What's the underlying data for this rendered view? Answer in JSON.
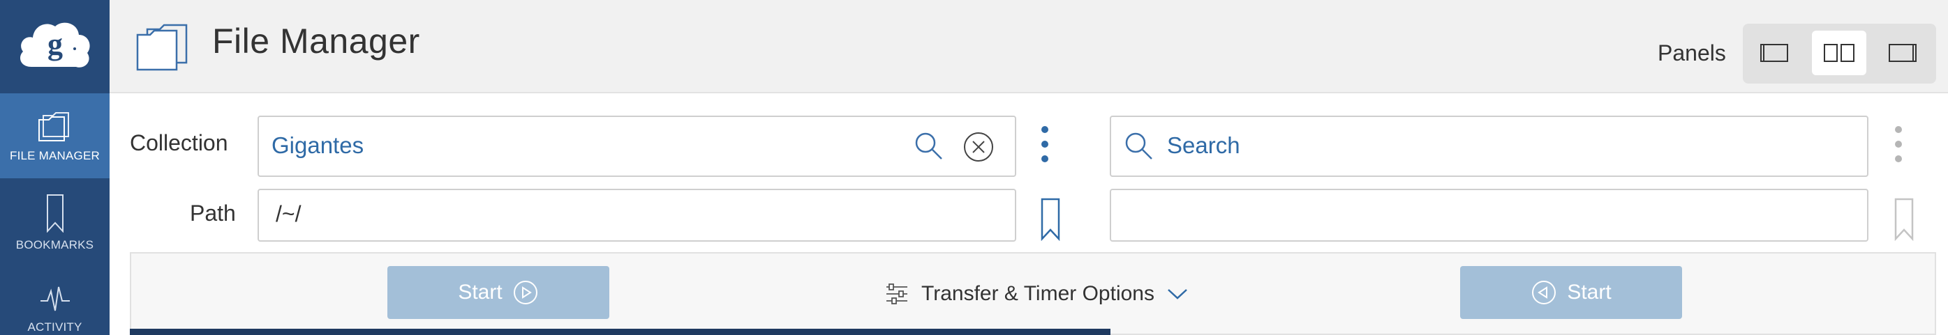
{
  "sidebar": {
    "items": [
      {
        "label": "FILE MANAGER",
        "icon": "folder-icon"
      },
      {
        "label": "BOOKMARKS",
        "icon": "bookmark-icon"
      },
      {
        "label": "ACTIVITY",
        "icon": "activity-icon"
      }
    ]
  },
  "header": {
    "title": "File Manager",
    "panels_label": "Panels"
  },
  "left_panel": {
    "collection_label": "Collection",
    "collection_value": "Gigantes",
    "path_label": "Path",
    "path_value": "/~/"
  },
  "right_panel": {
    "search_placeholder": "Search",
    "path_value": ""
  },
  "transfer": {
    "start_left_label": "Start",
    "start_right_label": "Start",
    "options_label": "Transfer & Timer Options"
  },
  "colors": {
    "sidebar": "#264a79",
    "sidebar_active": "#3b6faa",
    "link_blue": "#2f6aa6",
    "start_button": "#a3bfd8"
  }
}
